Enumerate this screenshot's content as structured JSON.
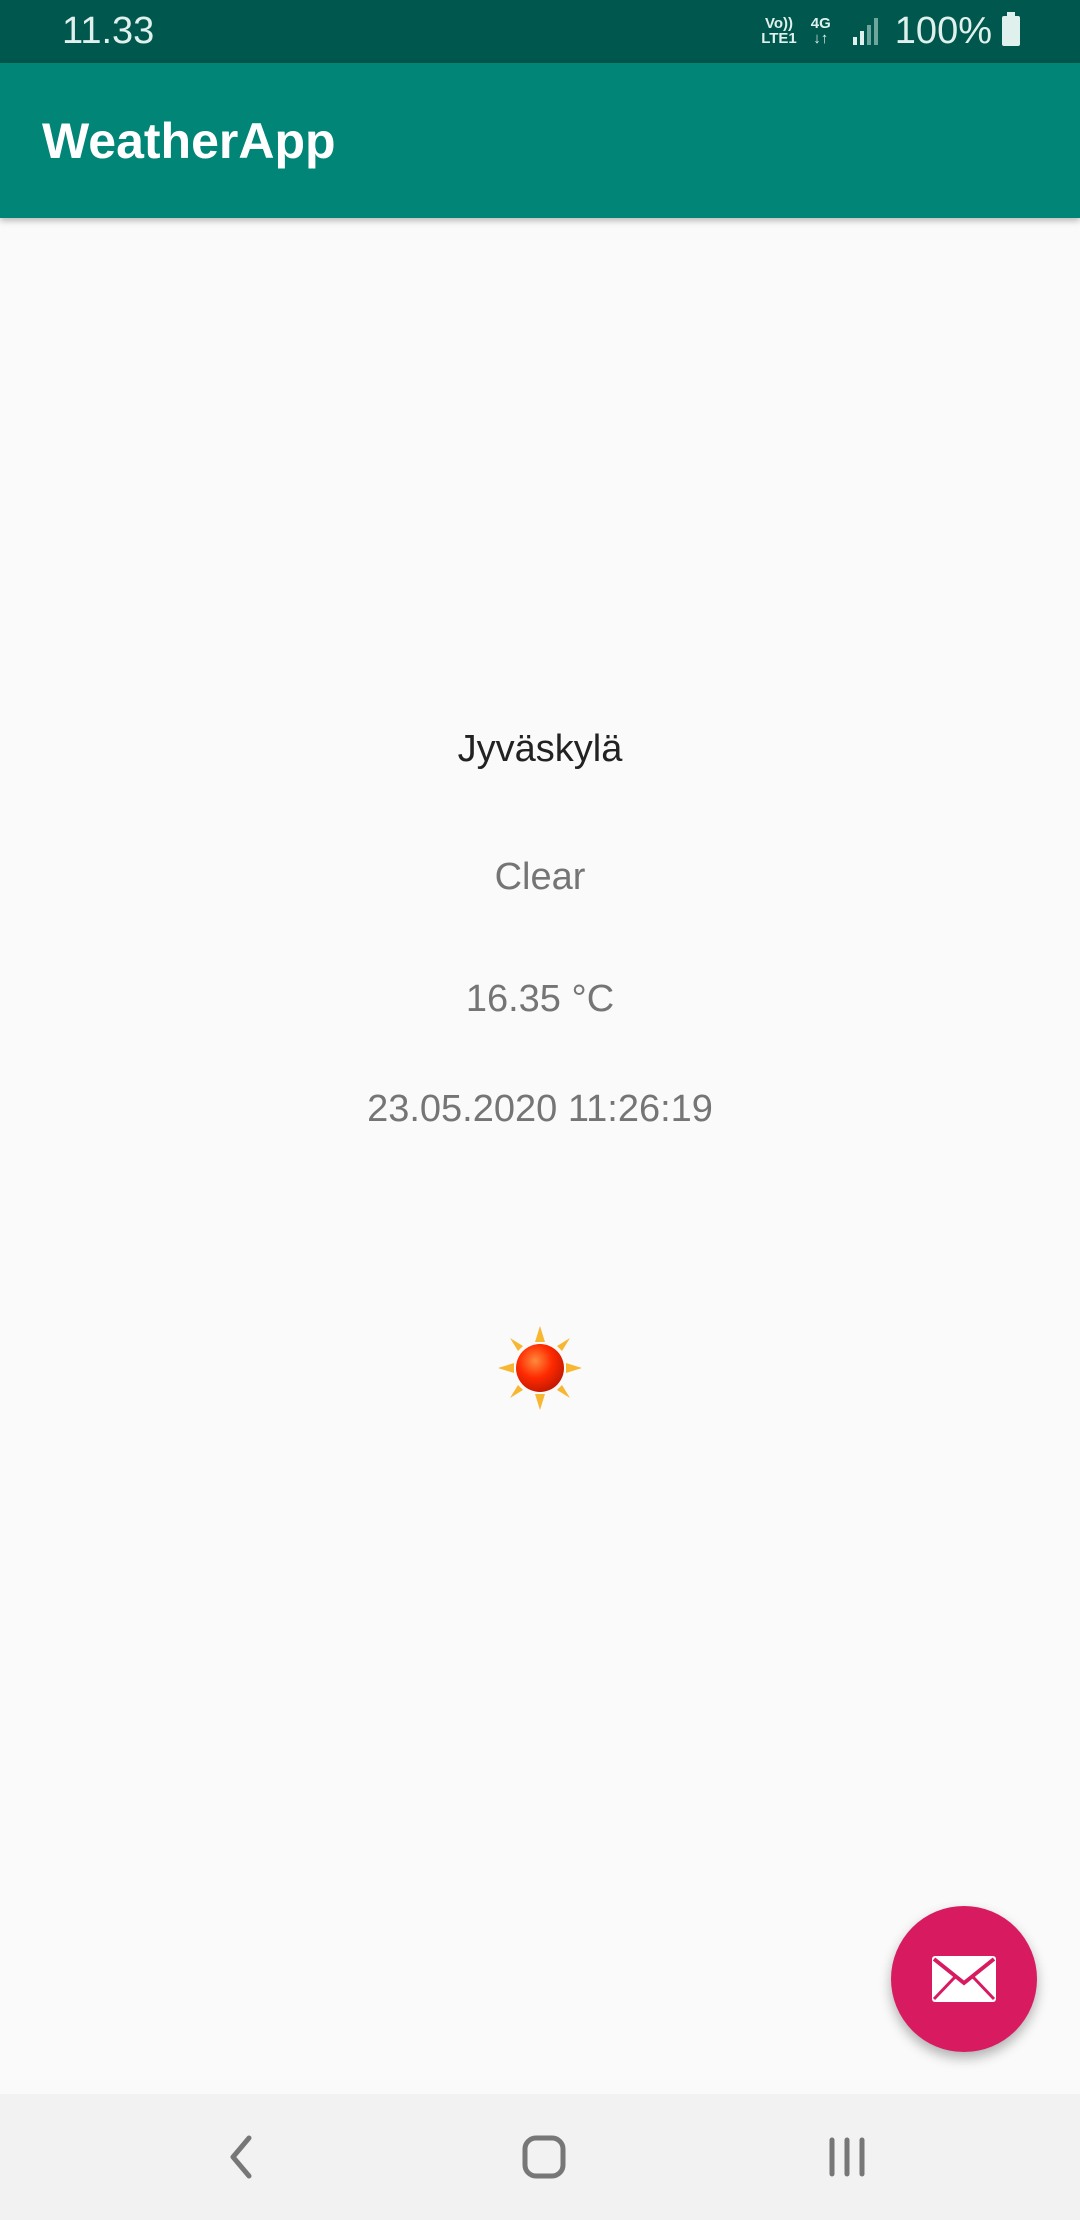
{
  "status_bar": {
    "time": "11.33",
    "volte_top": "Vo))",
    "volte_bottom": "LTE1",
    "network": "4G",
    "battery": "100%"
  },
  "app_bar": {
    "title": "WeatherApp"
  },
  "weather": {
    "city": "Jyväskylä",
    "condition": "Clear",
    "temperature": "16.35 °C",
    "datetime": "23.05.2020 11:26:19",
    "icon": "sun-icon"
  },
  "fab": {
    "icon": "mail-icon",
    "color": "#d81b60"
  },
  "nav_bar": {
    "back_icon": "back-chevron-icon",
    "home_icon": "home-icon",
    "recents_icon": "recents-icon"
  },
  "colors": {
    "primary": "#008577",
    "primary_dark": "#00574d",
    "accent": "#d81b60"
  }
}
